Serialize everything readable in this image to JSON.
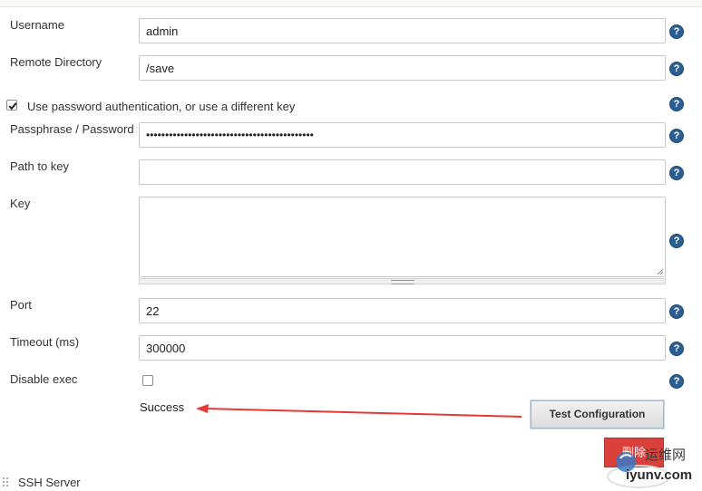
{
  "form": {
    "username": {
      "label": "Username",
      "value": "admin"
    },
    "remote_directory": {
      "label": "Remote Directory",
      "value": "/save"
    },
    "use_password_auth": {
      "label": "Use password authentication, or use a different key",
      "checked": true
    },
    "passphrase": {
      "label": "Passphrase / Password",
      "value": "••••••••••••••••••••••••••••••••••••••••••••"
    },
    "path_to_key": {
      "label": "Path to key",
      "value": ""
    },
    "key": {
      "label": "Key",
      "value": ""
    },
    "port": {
      "label": "Port",
      "value": "22"
    },
    "timeout": {
      "label": "Timeout (ms)",
      "value": "300000"
    },
    "disable_exec": {
      "label": "Disable exec",
      "checked": false
    }
  },
  "help_icon_glyph": "?",
  "status": {
    "result": "Success"
  },
  "actions": {
    "test_configuration": "Test Configuration",
    "delete": "删除"
  },
  "section": {
    "title": "SSH Server"
  },
  "watermark": {
    "site": "运维网",
    "url": "iyunv.com"
  },
  "colors": {
    "help_icon": "#2b5f93",
    "delete_button": "#d9413a",
    "arrow": "#e53935"
  }
}
